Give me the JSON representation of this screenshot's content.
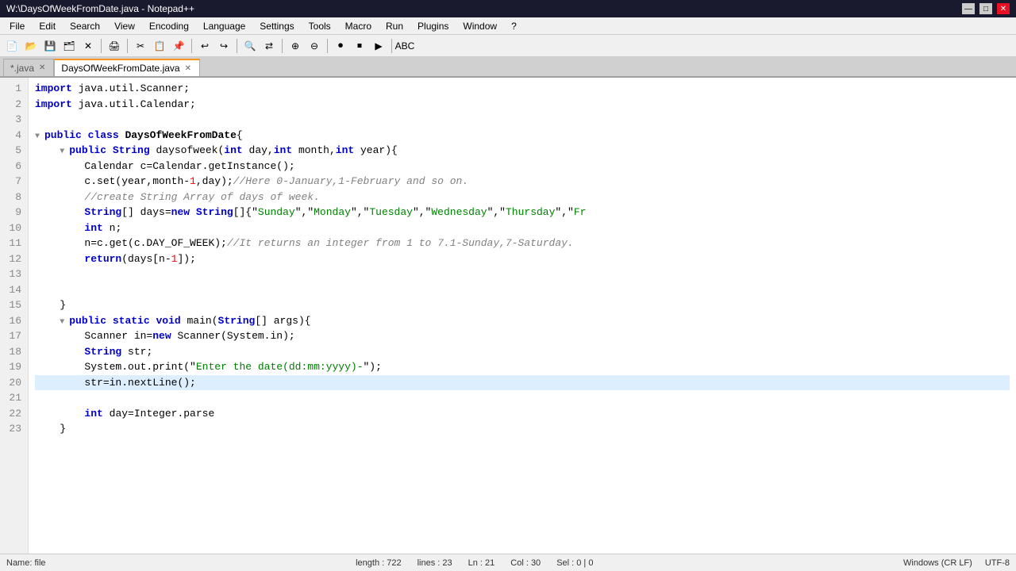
{
  "titleBar": {
    "title": "W:\\DaysOfWeekFromDate.java - Notepad++",
    "minBtn": "—",
    "maxBtn": "□",
    "closeBtn": "✕"
  },
  "menuBar": {
    "items": [
      "File",
      "Edit",
      "Search",
      "View",
      "Encoding",
      "Language",
      "Settings",
      "Tools",
      "Macro",
      "Run",
      "Plugins",
      "Window",
      "?"
    ]
  },
  "tabs": [
    {
      "label": "*.java",
      "active": false,
      "closeable": true
    },
    {
      "label": "DaysOfWeekFromDate.java",
      "active": true,
      "closeable": true
    }
  ],
  "statusBar": {
    "left": "Name: file",
    "length": "length : 722",
    "lines": "lines : 23",
    "ln": "Ln : 21",
    "col": "Col : 30",
    "sel": "Sel : 0 | 0",
    "lineEnding": "Windows (CR LF)",
    "encoding": "UTF-8"
  }
}
